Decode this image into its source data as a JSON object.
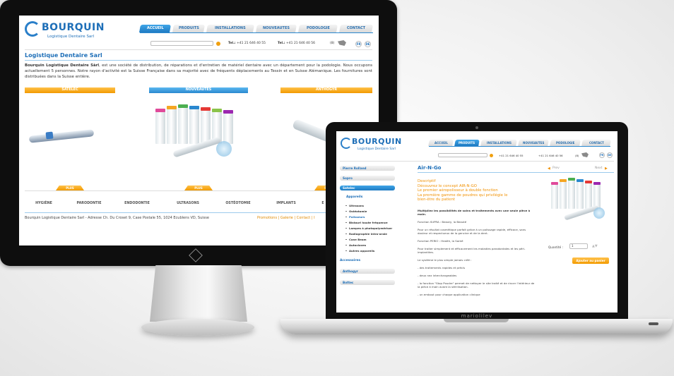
{
  "desktop": {
    "logo": {
      "brand": "BOURQUIN",
      "tagline": "Logistique Dentaire Sarl"
    },
    "nav": [
      {
        "label": "ACCUEIL",
        "active": true
      },
      {
        "label": "PRODUITS",
        "active": false
      },
      {
        "label": "INSTALLATIONS",
        "active": false
      },
      {
        "label": "NOUVEAUTES",
        "active": false
      },
      {
        "label": "PODOLOGIE",
        "active": false
      },
      {
        "label": "CONTACT",
        "active": false
      }
    ],
    "contact": {
      "tel_label": "Tel.:",
      "tel_value": "+41 21 646 40 55",
      "fax_label": "Tel.:",
      "fax_value": "+41 21 646 40 56",
      "badge": "(8)"
    },
    "langs": [
      "FR",
      "DE"
    ],
    "page_title": "Logistique Dentaire Sarl",
    "intro_bold": "Bourquin Logistique Dentaire Sàrl",
    "intro_text": ", est une société de distribution, de réparations et d'entretien de matériel dentaire avec un département pour la podologie. Nous occupons actuellement 5 personnes. Notre rayon d'activité est la Suisse Française dans sa majorité avec de fréquents déplacements au Tessin et en Suisse Alémanique. Les fournitures sont distribuées dans la Suisse entière.",
    "bands": [
      "SATELEC",
      "NOUVEAUTES",
      "ANTHOGYR"
    ],
    "plus_label": "PLUS",
    "bottom_nav": [
      "HYGIÈNE",
      "PARODONTIE",
      "ENDODONTIE",
      "ULTRASONS",
      "OSTÉOTOMIE",
      "IMPLANTS",
      "E"
    ],
    "footer_text": "Bourquin Logistique Dentaire Sarl - Adresse Ch. Du Croset 9, Case Postale 55, 1024 Ecublens VD, Suisse",
    "footer_links": [
      "Promotions",
      "Galerie",
      "Contact",
      "I"
    ]
  },
  "laptop": {
    "brand_label": "mariolilev",
    "logo": {
      "brand": "BOURQUIN",
      "tagline": "Logistique Dentaire Sarl"
    },
    "nav": [
      {
        "label": "ACCUEIL",
        "active": false
      },
      {
        "label": "PRODUITS",
        "active": true
      },
      {
        "label": "INSTALLATIONS",
        "active": false
      },
      {
        "label": "NOUVEAUTES",
        "active": false
      },
      {
        "label": "PODOLOGIE",
        "active": false
      },
      {
        "label": "CONTACT",
        "active": false
      }
    ],
    "contact": {
      "tel_value": "+41 21 646 40 55",
      "fax_value": "+41 21 646 40 56",
      "badge": "(8)"
    },
    "langs": [
      "FR",
      "DE"
    ],
    "sidebar": {
      "tabs_top": [
        "Pierre Rolland",
        "Sopro",
        "Satelec"
      ],
      "group": "Appareils",
      "items": [
        "Ultrasons",
        "Ostéotomie",
        "Polisseurs",
        "Bistouri haute fréquence",
        "Lampes à photopolymériser",
        "Radiographie intra-orale",
        "Cone Beam",
        "Autoclaves",
        "Autres appareils"
      ],
      "accessories": "Accessoires",
      "tabs_bottom": [
        "Anthogyr",
        "Bottec"
      ]
    },
    "product": {
      "title": "Air-N-Go",
      "prev": "Prev",
      "next": "Next",
      "orange_lines": [
        "Descriptif",
        "Découvrez le concept AIR-N-GO",
        "Le premier aéropolisseur à double fonction",
        "La première gamme de poudres qui privilégie le",
        "bien-être du patient"
      ],
      "lead": "Multipliez les possibilités de soins et traitements avec une seule pièce à main.",
      "p1": "Fonction SUPRA : Beauty, la Beauté",
      "p2": "Pour un résultat cosmétique parfait grâce à un polissage rapide, efficace, sans douleur et respectueux de la gencive et de la dent.",
      "p3": "Fonction PERIO : Health, la Santé",
      "p4": "Pour traiter simplement et efficacement les maladies parodontales et les péri-implantites.",
      "p5": "Le système le plus simple jamais créé :",
      "p6": "- des traitements rapides et précis",
      "p7": "- deux nez interchangeables",
      "p8": "- la fonction \"Stop Poudre\" permet de nettoyer le site traité et de rincer l'intérieur de la pièce à main avant la stérilisation.",
      "p9": "- un embout pour chaque application clinique",
      "qty_label": "Quantité :",
      "qty_value": "1",
      "cart_button": "Ajouter au panier"
    }
  }
}
